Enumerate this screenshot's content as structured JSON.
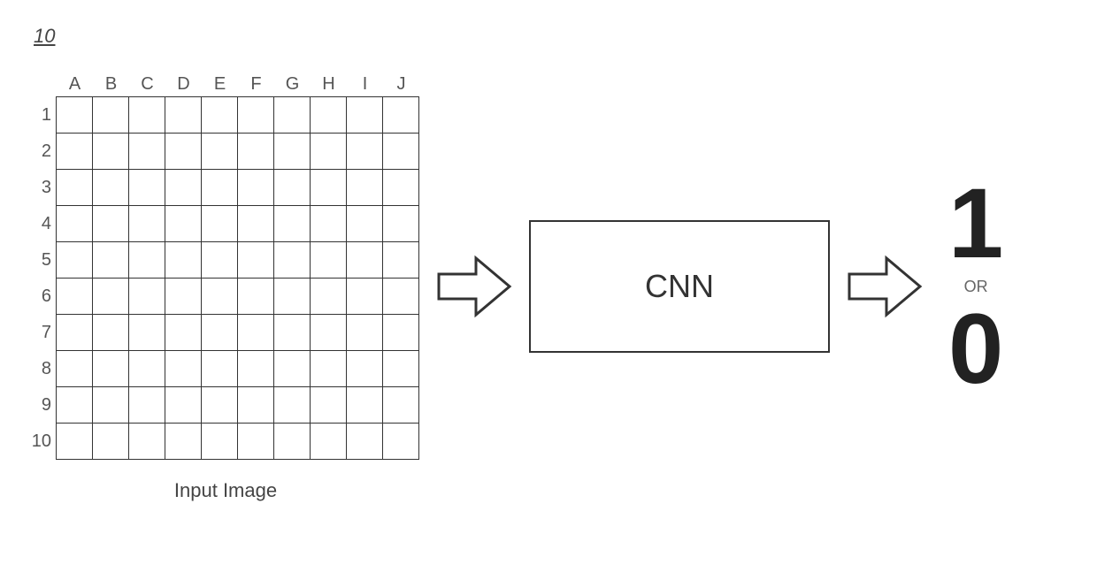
{
  "figure_number": "10",
  "grid": {
    "columns": [
      "A",
      "B",
      "C",
      "D",
      "E",
      "F",
      "G",
      "H",
      "I",
      "J"
    ],
    "rows": [
      "1",
      "2",
      "3",
      "4",
      "5",
      "6",
      "7",
      "8",
      "9",
      "10"
    ],
    "caption": "Input Image"
  },
  "box_label": "CNN",
  "output": {
    "top": "1",
    "or": "OR",
    "bottom": "0"
  }
}
